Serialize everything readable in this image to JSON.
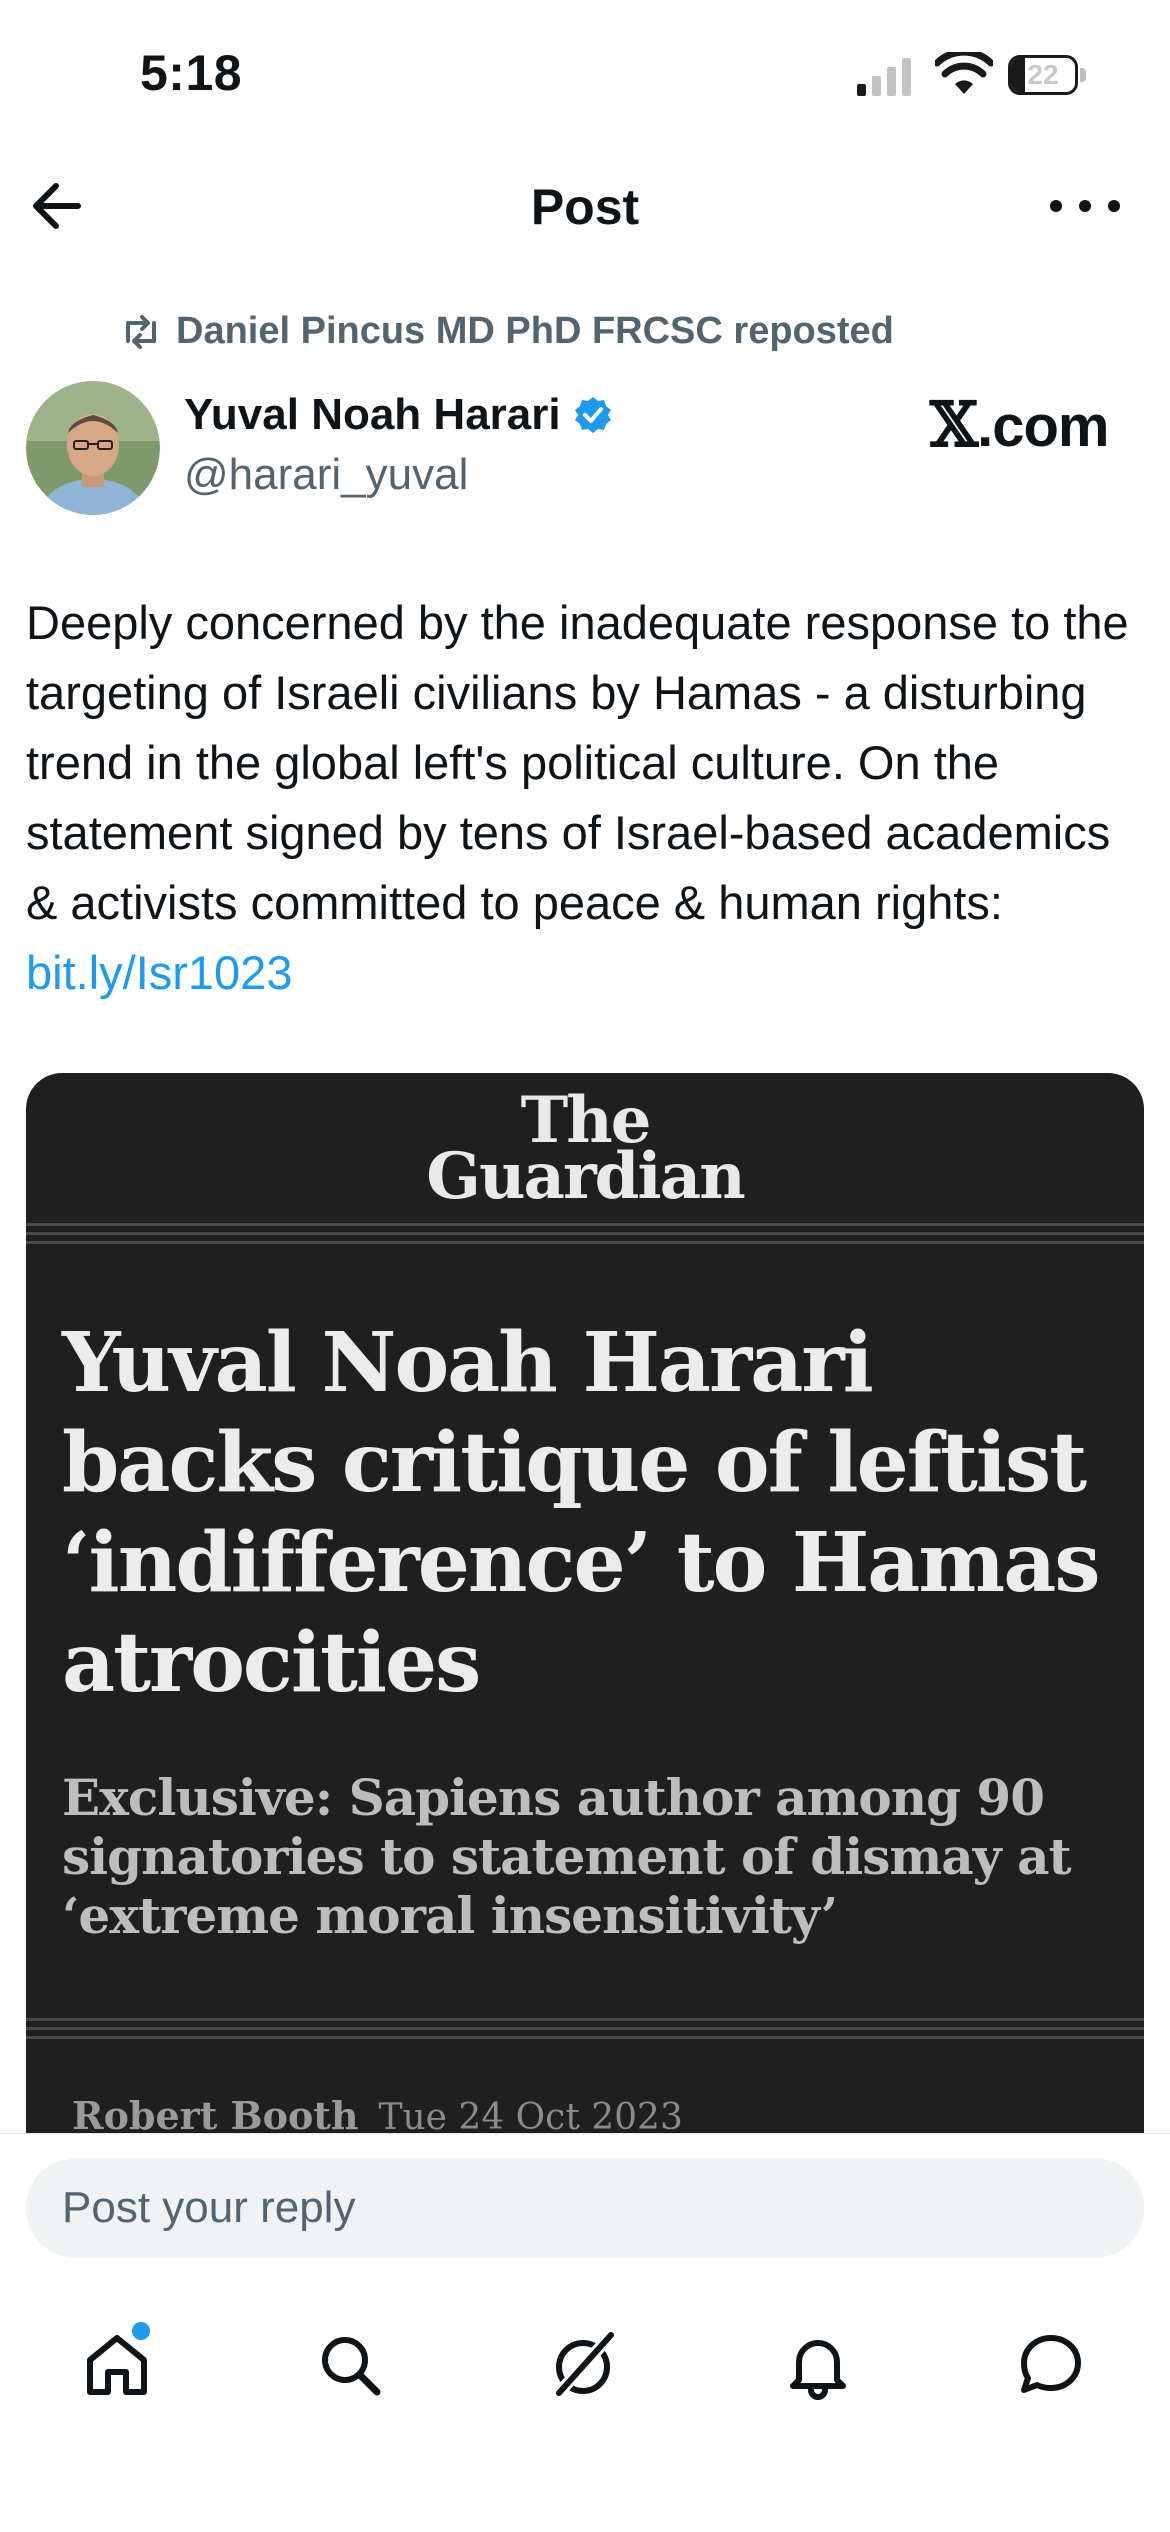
{
  "status_bar": {
    "time": "5:18",
    "battery_level": "22",
    "icons": [
      "signal-icon",
      "wifi-icon",
      "battery-icon"
    ]
  },
  "header": {
    "title": "Post",
    "back_icon": "arrow-left-icon",
    "more_icon": "more-horizontal-icon"
  },
  "repost": {
    "icon": "repost-icon",
    "text": "Daniel Pincus MD PhD FRCSC reposted"
  },
  "author": {
    "name": "Yuval Noah Harari",
    "handle": "@harari_yuval",
    "verified": true,
    "avatar_icon": "avatar-photo"
  },
  "source_badge": {
    "x_glyph": "𝕏",
    "suffix": ".com"
  },
  "tweet": {
    "text": "Deeply concerned by the inadequate response to the targeting of Israeli civilians by Hamas - a disturbing trend in the global left's political culture. On the statement signed by tens of Israel-based academics & activists committed to peace & human rights: ",
    "link": "bit.ly/Isr1023"
  },
  "card": {
    "logo_line1": "The",
    "logo_line2": "Guardian",
    "headline": "Yuval Noah Harari backs critique of leftist ‘indifference’ to Hamas atrocities",
    "standfirst": "Exclusive: Sapiens author among 90 signatories to statement of dismay at ‘extreme moral insensitivity’",
    "byline_author": "Robert Booth",
    "byline_date": "Tue 24 Oct 2023"
  },
  "reply": {
    "placeholder": "Post your reply"
  },
  "nav": {
    "items": [
      "home-icon",
      "search-icon",
      "grok-icon",
      "notifications-icon",
      "messages-icon"
    ],
    "home_has_badge": true
  },
  "colors": {
    "accent": "#1d9bf0",
    "text_primary": "#0f1419",
    "text_secondary": "#536471",
    "card_bg": "#1f1f1f",
    "reply_bg": "#eff3f4"
  }
}
